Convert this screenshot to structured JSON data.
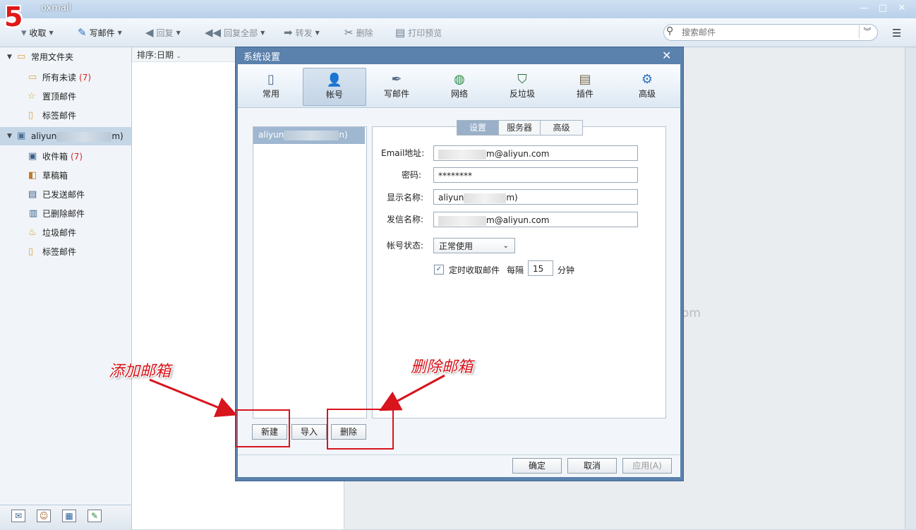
{
  "step_badge": "5",
  "app_title": "oxmail",
  "window_controls": {
    "minimize": "—",
    "maximize": "□",
    "close": "✕"
  },
  "toolbar": {
    "receive": "收取",
    "compose": "写邮件",
    "reply": "回复",
    "reply_all": "回复全部",
    "forward": "转发",
    "delete": "删除",
    "print_preview": "打印预览"
  },
  "search": {
    "placeholder": "搜索邮件"
  },
  "sidebar": {
    "common_folders": "常用文件夹",
    "all_unread": "所有未读",
    "all_unread_count": "(7)",
    "pinned": "置顶邮件",
    "tagged": "标签邮件",
    "account_prefix": "aliyun",
    "account_suffix": "m)",
    "inbox": "收件箱",
    "inbox_count": "(7)",
    "drafts": "草稿箱",
    "sent": "已发送邮件",
    "deleted": "已删除邮件",
    "junk": "垃圾邮件",
    "tagged2": "标签邮件"
  },
  "list": {
    "sort_label": "排序:日期"
  },
  "reading_partial": "om",
  "dialog": {
    "title": "系统设置",
    "close": "✕",
    "tabs": [
      "常用",
      "帐号",
      "写邮件",
      "网络",
      "反垃圾",
      "插件",
      "高级"
    ],
    "account_item_prefix": "aliyun",
    "account_item_suffix": "n)",
    "subtabs": [
      "设置",
      "服务器",
      "高级"
    ],
    "fields": {
      "email_label": "Email地址:",
      "email_value": "m@aliyun.com",
      "password_label": "密码:",
      "password_value": "********",
      "display_label": "显示名称:",
      "display_prefix": "aliyun",
      "display_suffix": "m)",
      "sender_label": "发信名称:",
      "sender_value": "m@aliyun.com",
      "status_label": "帐号状态:",
      "status_value": "正常使用",
      "auto_check_label": "定时收取邮件",
      "every_label": "每隔",
      "interval_value": "15",
      "minutes_label": "分钟"
    },
    "buttons": {
      "new": "新建",
      "import": "导入",
      "delete": "删除",
      "ok": "确定",
      "cancel": "取消",
      "apply": "应用(A)"
    }
  },
  "annotations": {
    "add_mailbox": "添加邮箱",
    "delete_mailbox": "删除邮箱",
    "color": "#d8141c"
  }
}
